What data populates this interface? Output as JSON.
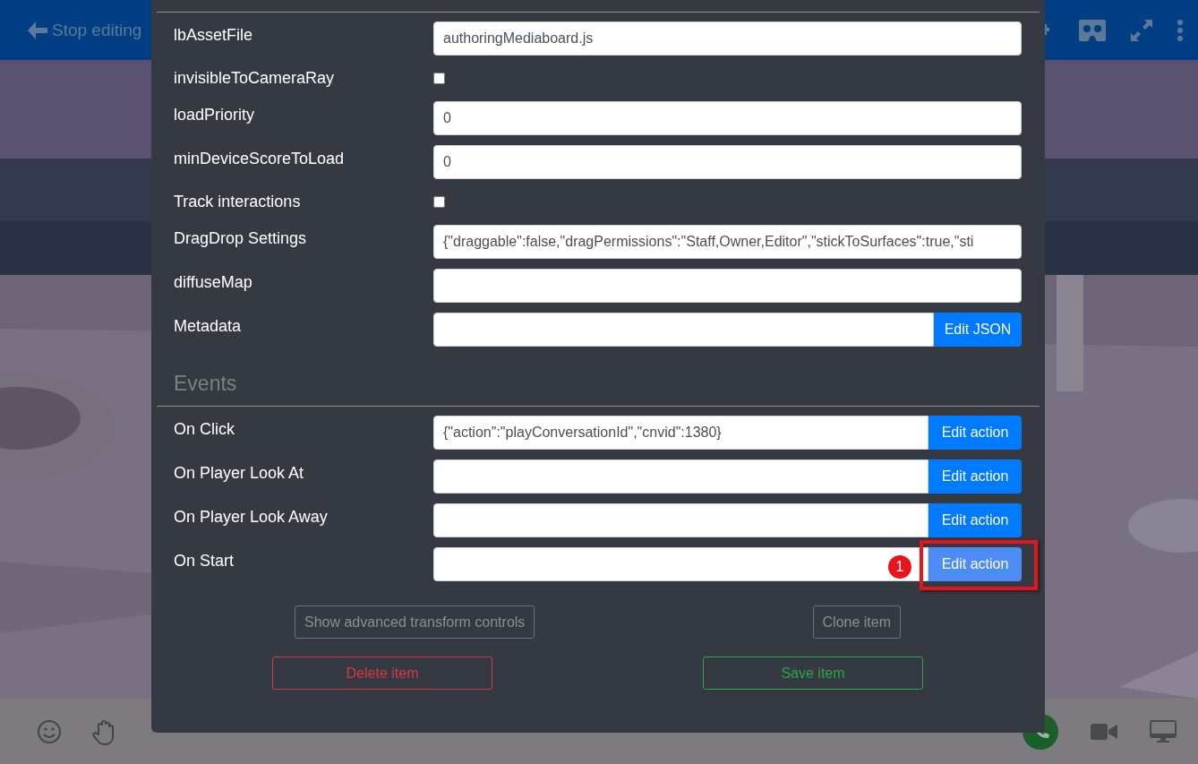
{
  "top_bar": {
    "back_label": "Stop editing"
  },
  "properties": [
    {
      "kind": "text",
      "label": "lbAssetFile",
      "value": "authoringMediaboard.js"
    },
    {
      "kind": "checkbox",
      "label": "invisibleToCameraRay",
      "checked": false
    },
    {
      "kind": "text",
      "label": "loadPriority",
      "value": "0"
    },
    {
      "kind": "text",
      "label": "minDeviceScoreToLoad",
      "value": "0"
    },
    {
      "kind": "checkbox",
      "label": "Track interactions",
      "checked": false
    },
    {
      "kind": "text",
      "label": "DragDrop Settings",
      "value": "{\"draggable\":false,\"dragPermissions\":\"Staff,Owner,Editor\",\"stickToSurfaces\":true,\"sti"
    },
    {
      "kind": "text",
      "label": "diffuseMap"
    },
    {
      "kind": "button",
      "label": "Metadata",
      "button": "Edit JSON"
    }
  ],
  "events_heading": "Events",
  "events": [
    {
      "label": "On Click",
      "value": "{\"action\":\"playConversationId\",\"cnvid\":1380}",
      "button": "Edit action",
      "highlighted": false
    },
    {
      "label": "On Player Look At",
      "button": "Edit action",
      "highlighted": false
    },
    {
      "label": "On Player Look Away",
      "button": "Edit action",
      "highlighted": false
    },
    {
      "label": "On Start",
      "button": "Edit action",
      "highlighted": true,
      "badge": "1"
    }
  ],
  "actions": {
    "advanced": "Show advanced transform controls",
    "clone": "Clone item",
    "delete": "Delete item",
    "save": "Save item"
  }
}
